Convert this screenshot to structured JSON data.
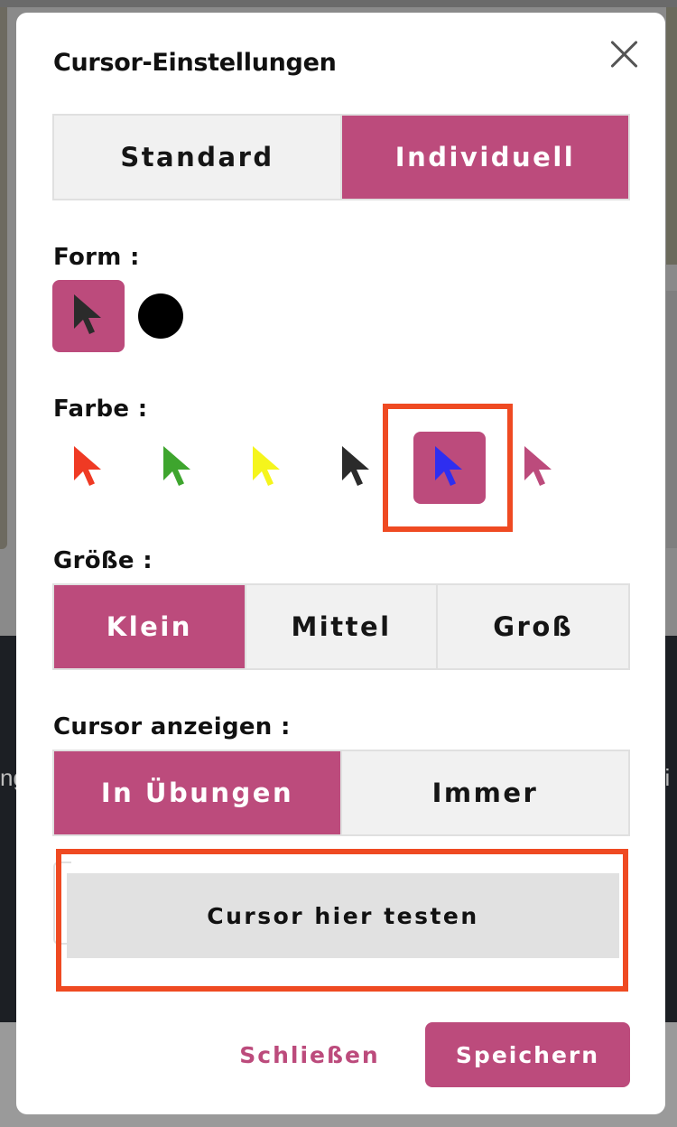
{
  "background": {
    "left_text": "ng",
    "right_text": "t:i"
  },
  "modal": {
    "title": "Cursor-Einstellungen",
    "mode_tabs": [
      {
        "label": "Standard",
        "active": false
      },
      {
        "label": "Individuell",
        "active": true
      }
    ],
    "form": {
      "label": "Form :",
      "options": [
        {
          "name": "arrow",
          "active": true
        },
        {
          "name": "circle",
          "active": false
        }
      ]
    },
    "farbe": {
      "label": "Farbe :",
      "options": [
        {
          "name": "red",
          "color": "#ef3a24",
          "active": false
        },
        {
          "name": "green",
          "color": "#3ea52e",
          "active": false
        },
        {
          "name": "yellow",
          "color": "#f5f51c",
          "active": false
        },
        {
          "name": "black",
          "color": "#2b2b2b",
          "active": false
        },
        {
          "name": "blue",
          "color": "#2e2ef0",
          "active": true
        },
        {
          "name": "pink",
          "color": "#bc4b7c",
          "active": false
        }
      ]
    },
    "groesse": {
      "label": "Größe :",
      "options": [
        {
          "label": "Klein",
          "active": true
        },
        {
          "label": "Mittel",
          "active": false
        },
        {
          "label": "Groß",
          "active": false
        }
      ]
    },
    "anzeigen": {
      "label": "Cursor anzeigen :",
      "options": [
        {
          "label": "In Übungen",
          "active": true
        },
        {
          "label": "Immer",
          "active": false
        }
      ]
    },
    "test_area_label": "Cursor hier testen",
    "buttons": {
      "close_label": "Schließen",
      "save_label": "Speichern"
    }
  },
  "colors": {
    "accent": "#bc4b7c",
    "highlight": "#ef4a22"
  }
}
